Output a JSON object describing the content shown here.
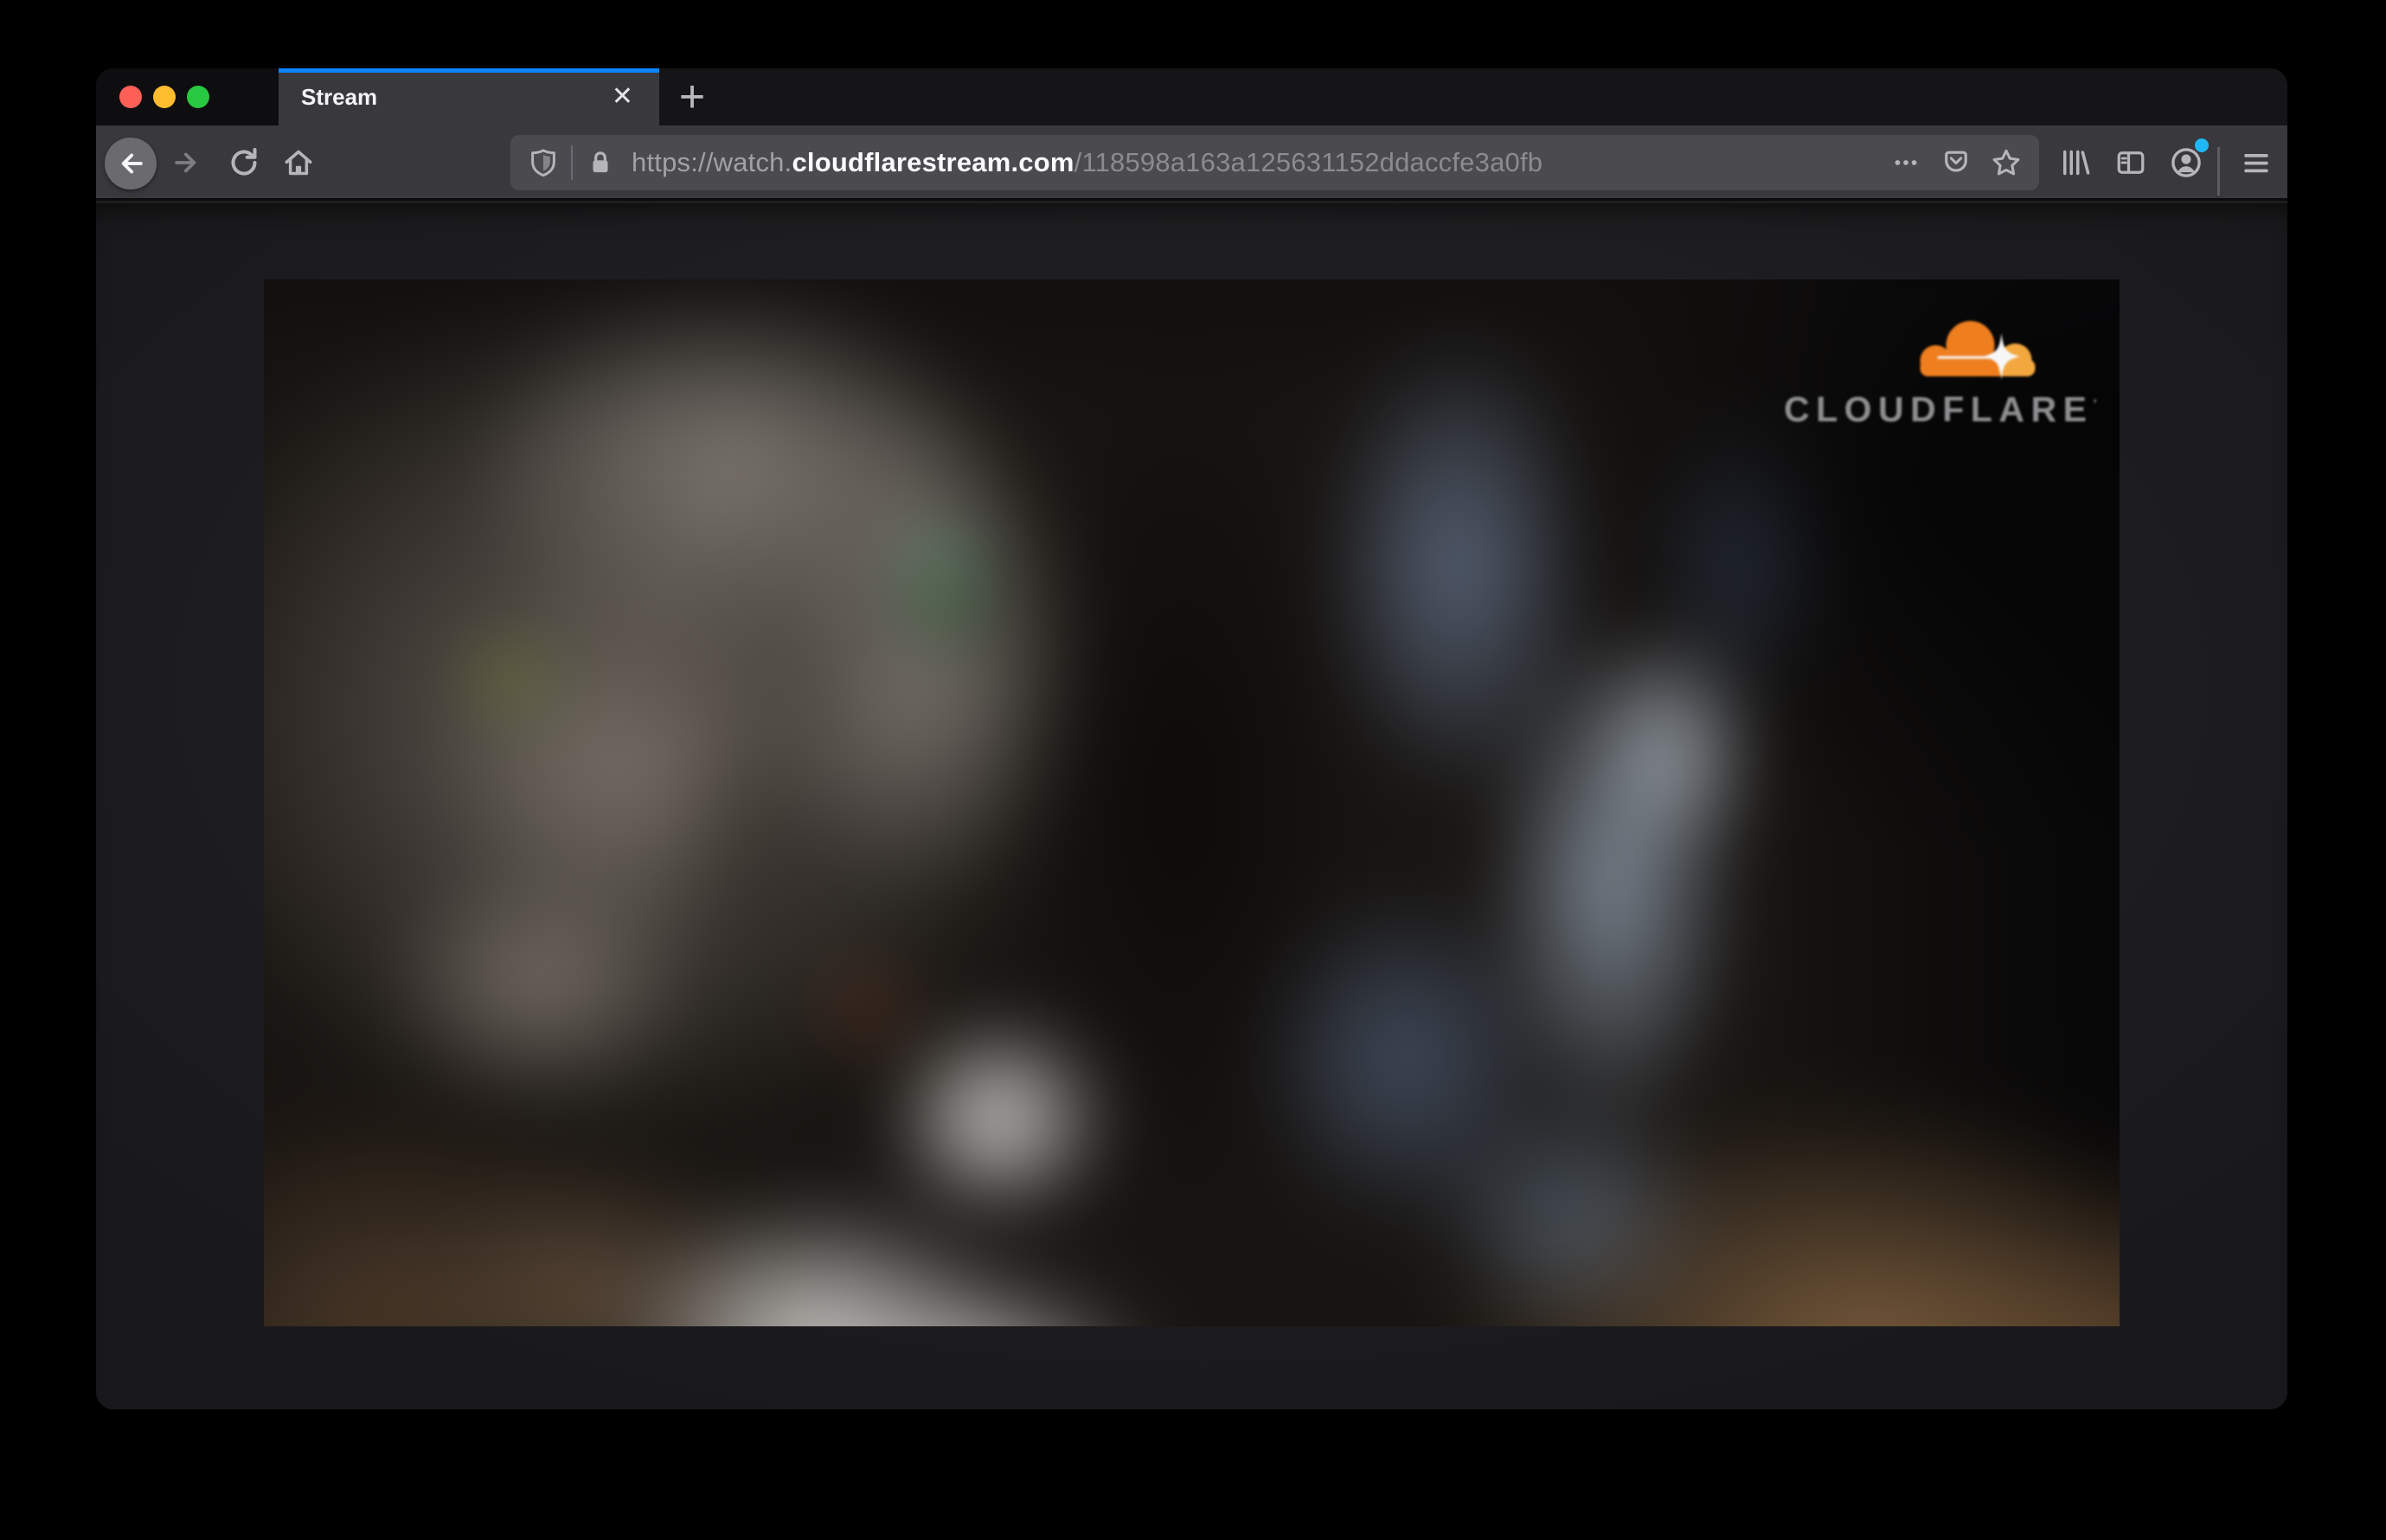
{
  "window": {
    "traffic_lights": {
      "close": "close-window",
      "minimize": "minimize-window",
      "zoom": "zoom-window"
    },
    "tab_strip": {
      "active_tab": {
        "title": "Stream",
        "close_glyph": "✕"
      },
      "new_tab_glyph": "+"
    },
    "navigation": {
      "url": {
        "prefix": "https://watch.",
        "domain": "cloudflarestream.com",
        "path": "/118598a163a125631152ddaccfe3a0fb"
      },
      "icons": [
        "back-icon",
        "forward-icon",
        "reload-icon",
        "home-icon",
        "tracking-protection-shield-icon",
        "lock-icon",
        "page-actions-ellipsis-icon",
        "pocket-icon",
        "bookmark-star-icon",
        "library-icon",
        "sidebar-icon",
        "account-icon",
        "menu-hamburger-icon"
      ]
    }
  },
  "player": {
    "watermark": "CLOUDFLARE",
    "watermark_tm": "’"
  },
  "colors": {
    "accent_blue": "#0a84ff",
    "traffic_red": "#ff5f57",
    "traffic_yellow": "#febc2e",
    "traffic_green": "#28c840",
    "notification_dot": "#1fb8f5",
    "cloudflare_orange": "#f6821f",
    "cloudflare_orange_light": "#fbad41",
    "toolbar_bg": "#38383d",
    "urlbar_bg": "#4a4a4f",
    "tabstrip_bg": "#151518"
  }
}
